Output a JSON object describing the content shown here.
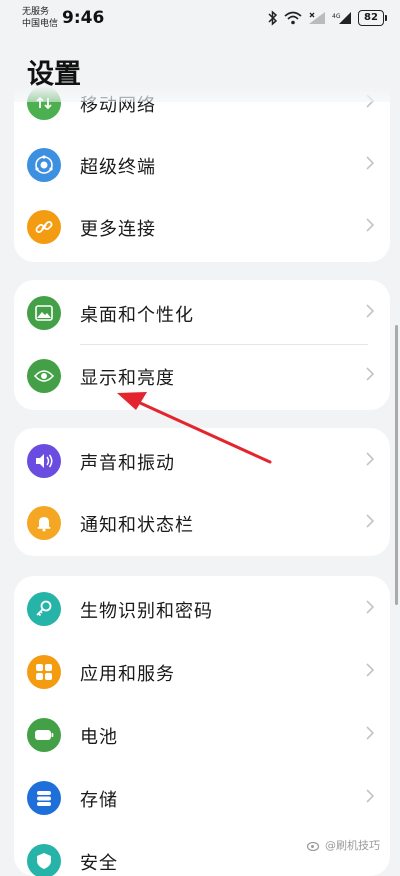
{
  "status": {
    "carrier_line1": "无服务",
    "carrier_line2": "中国电信",
    "time": "9:46",
    "battery": "82"
  },
  "page": {
    "title": "设置"
  },
  "groups": [
    {
      "items": [
        {
          "label": "移动网络",
          "icon": "mobile-network-icon",
          "color": "#4caf50"
        },
        {
          "label": "超级终端",
          "icon": "super-device-icon",
          "color": "#3d8fe0"
        },
        {
          "label": "更多连接",
          "icon": "link-icon",
          "color": "#f39c12"
        }
      ]
    },
    {
      "items": [
        {
          "label": "桌面和个性化",
          "icon": "wallpaper-icon",
          "color": "#43a047"
        },
        {
          "label": "显示和亮度",
          "icon": "eye-icon",
          "color": "#43a047"
        }
      ]
    },
    {
      "items": [
        {
          "label": "声音和振动",
          "icon": "speaker-icon",
          "color": "#6a4de0"
        },
        {
          "label": "通知和状态栏",
          "icon": "bell-icon",
          "color": "#f5a623"
        }
      ]
    },
    {
      "items": [
        {
          "label": "生物识别和密码",
          "icon": "key-icon",
          "color": "#26b3a8"
        },
        {
          "label": "应用和服务",
          "icon": "apps-icon",
          "color": "#f39c12"
        },
        {
          "label": "电池",
          "icon": "battery-icon",
          "color": "#43a047"
        },
        {
          "label": "存储",
          "icon": "storage-icon",
          "color": "#1e6fd9"
        },
        {
          "label": "安全",
          "icon": "shield-icon",
          "color": "#26b3a8"
        }
      ]
    }
  ],
  "watermark": "@刷机技巧"
}
